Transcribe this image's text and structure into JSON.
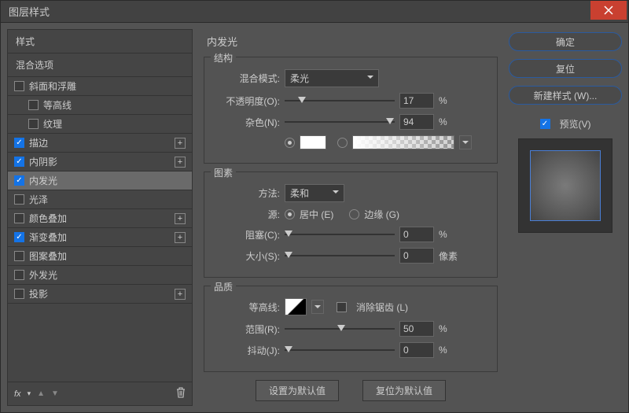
{
  "title": "图层样式",
  "sidebar": {
    "styles_header": "样式",
    "blending_header": "混合选项",
    "items": [
      {
        "label": "斜面和浮雕",
        "checked": false,
        "has_plus": false,
        "indent": false
      },
      {
        "label": "等高线",
        "checked": false,
        "has_plus": false,
        "indent": true
      },
      {
        "label": "纹理",
        "checked": false,
        "has_plus": false,
        "indent": true
      },
      {
        "label": "描边",
        "checked": true,
        "has_plus": true,
        "indent": false
      },
      {
        "label": "内阴影",
        "checked": true,
        "has_plus": true,
        "indent": false
      },
      {
        "label": "内发光",
        "checked": true,
        "has_plus": false,
        "indent": false,
        "selected": true
      },
      {
        "label": "光泽",
        "checked": false,
        "has_plus": false,
        "indent": false
      },
      {
        "label": "颜色叠加",
        "checked": false,
        "has_plus": true,
        "indent": false
      },
      {
        "label": "渐变叠加",
        "checked": true,
        "has_plus": true,
        "indent": false
      },
      {
        "label": "图案叠加",
        "checked": false,
        "has_plus": false,
        "indent": false
      },
      {
        "label": "外发光",
        "checked": false,
        "has_plus": false,
        "indent": false
      },
      {
        "label": "投影",
        "checked": false,
        "has_plus": true,
        "indent": false
      }
    ],
    "fx": "fx"
  },
  "panel": {
    "title": "内发光",
    "structure": {
      "title": "结构",
      "blend_mode_label": "混合模式:",
      "blend_mode_value": "柔光",
      "opacity_label": "不透明度(O):",
      "opacity_value": "17",
      "opacity_unit": "%",
      "opacity_pos": "12%",
      "noise_label": "杂色(N):",
      "noise_value": "94",
      "noise_unit": "%",
      "noise_pos": "92%"
    },
    "elements": {
      "title": "图素",
      "technique_label": "方法:",
      "technique_value": "柔和",
      "source_label": "源:",
      "center_label": "居中 (E)",
      "edge_label": "边缘 (G)",
      "choke_label": "阻塞(C):",
      "choke_value": "0",
      "choke_unit": "%",
      "choke_pos": "0%",
      "size_label": "大小(S):",
      "size_value": "0",
      "size_unit": "像素",
      "size_pos": "0%"
    },
    "quality": {
      "title": "品质",
      "contour_label": "等高线:",
      "antialias_label": "消除锯齿 (L)",
      "range_label": "范围(R):",
      "range_value": "50",
      "range_unit": "%",
      "range_pos": "48%",
      "jitter_label": "抖动(J):",
      "jitter_value": "0",
      "jitter_unit": "%",
      "jitter_pos": "0%"
    },
    "make_default": "设置为默认值",
    "reset_default": "复位为默认值"
  },
  "actions": {
    "ok": "确定",
    "cancel": "复位",
    "new_style": "新建样式 (W)...",
    "preview": "预览(V)"
  }
}
